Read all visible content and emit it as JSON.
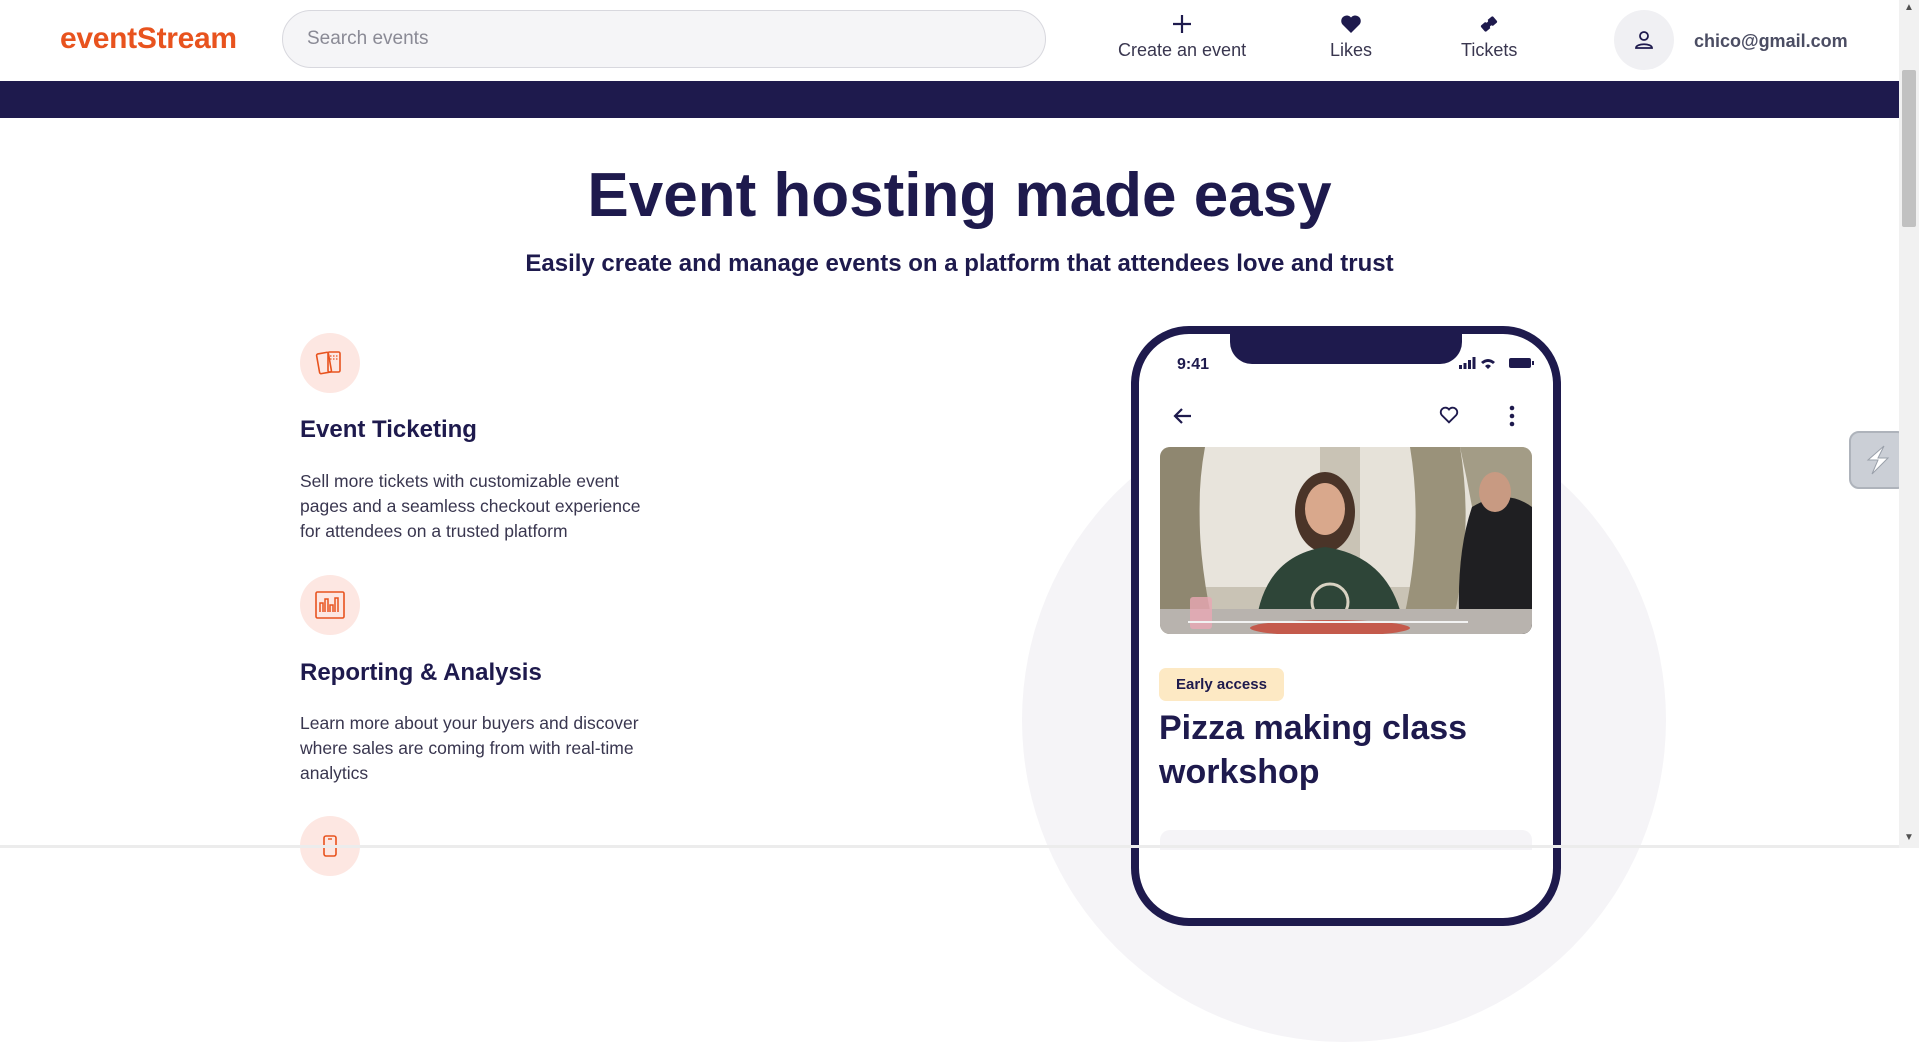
{
  "header": {
    "logo": "eventStream",
    "search_placeholder": "Search events",
    "actions": [
      {
        "label": "Create an event",
        "icon": "plus-icon"
      },
      {
        "label": "Likes",
        "icon": "heart-icon"
      },
      {
        "label": "Tickets",
        "icon": "ticket-icon"
      }
    ],
    "user_email": "chico@gmail.com"
  },
  "hero": {
    "title": "Event hosting made easy",
    "subtitle": "Easily create and manage events on a platform that attendees love and trust"
  },
  "features": [
    {
      "icon": "tickets-icon",
      "title": "Event Ticketing",
      "description": "Sell more tickets with customizable event pages and a seamless checkout experience for attendees on a trusted platform"
    },
    {
      "icon": "analytics-chart-icon",
      "title": "Reporting & Analysis",
      "description": "Learn more about your buyers and discover where sales are coming from with real-time analytics"
    },
    {
      "icon": "mobile-phone-icon"
    }
  ],
  "phone": {
    "status_time": "9:41",
    "badge": "Early access",
    "event_title": "Pizza making class workshop"
  },
  "colors": {
    "brand": "#e8531e",
    "navy": "#1e1a4d",
    "badge_bg": "#fde9c4",
    "icon_bg": "#fde7e2"
  }
}
